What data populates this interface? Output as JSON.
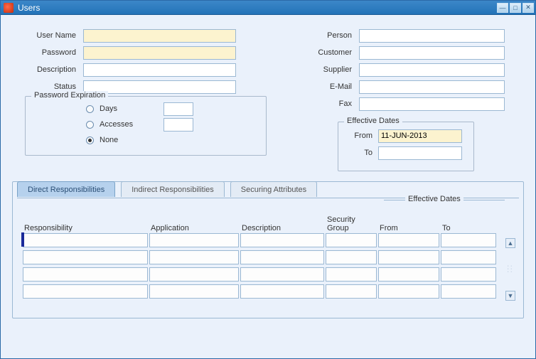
{
  "window": {
    "title": "Users"
  },
  "left_form": {
    "user_name": {
      "label": "User Name",
      "value": ""
    },
    "password": {
      "label": "Password",
      "value": ""
    },
    "description": {
      "label": "Description",
      "value": ""
    },
    "status": {
      "label": "Status",
      "value": ""
    }
  },
  "right_form": {
    "person": {
      "label": "Person",
      "value": ""
    },
    "customer": {
      "label": "Customer",
      "value": ""
    },
    "supplier": {
      "label": "Supplier",
      "value": ""
    },
    "email": {
      "label": "E-Mail",
      "value": ""
    },
    "fax": {
      "label": "Fax",
      "value": ""
    }
  },
  "password_expiration": {
    "legend": "Password Expiration",
    "options": {
      "days": {
        "label": "Days",
        "selected": false
      },
      "accesses": {
        "label": "Accesses",
        "selected": false
      },
      "none": {
        "label": "None",
        "selected": true
      }
    }
  },
  "effective_dates_top": {
    "legend": "Effective Dates",
    "from": {
      "label": "From",
      "value": "11-JUN-2013"
    },
    "to": {
      "label": "To",
      "value": ""
    }
  },
  "tabs": {
    "direct": {
      "label": "Direct Responsibilities",
      "active": true
    },
    "indirect": {
      "label": "Indirect Responsibilities",
      "active": false
    },
    "securing": {
      "label": "Securing Attributes",
      "active": false
    }
  },
  "grid": {
    "eff_legend": "Effective Dates",
    "headers": {
      "responsibility": "Responsibility",
      "application": "Application",
      "description": "Description",
      "security_top": "Security",
      "security_bot": "Group",
      "from": "From",
      "to": "To"
    },
    "rows": [
      {
        "responsibility": "",
        "application": "",
        "description": "",
        "security_group": "",
        "from": "",
        "to": ""
      },
      {
        "responsibility": "",
        "application": "",
        "description": "",
        "security_group": "",
        "from": "",
        "to": ""
      },
      {
        "responsibility": "",
        "application": "",
        "description": "",
        "security_group": "",
        "from": "",
        "to": ""
      },
      {
        "responsibility": "",
        "application": "",
        "description": "",
        "security_group": "",
        "from": "",
        "to": ""
      }
    ]
  }
}
